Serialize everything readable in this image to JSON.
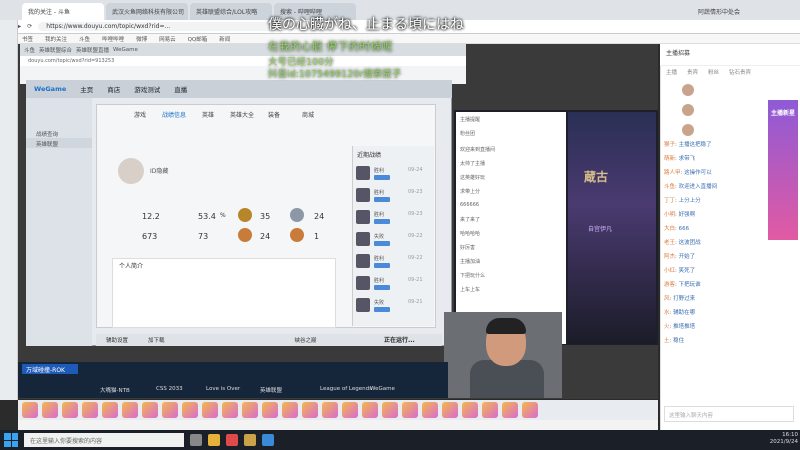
{
  "browser": {
    "tabs": [
      "我的关注 - 斗鱼",
      "武汉火鱼网络科技有限公司",
      "英雄联盟综合/LOL攻略",
      "搜索 - 哔哩哔哩"
    ],
    "url": "https://www.douyu.com/topic/wxd?rid=...",
    "bookmarks": [
      "书签",
      "我的关注",
      "斗鱼",
      "哔哩哔哩",
      "微博",
      "网易云",
      "QQ邮箱",
      "新闻"
    ],
    "user": "阿蔬情形中处会"
  },
  "inner_browser": {
    "tabs": [
      "斗鱼",
      "英雄联盟综合",
      "英雄联盟直播",
      "WeGame"
    ],
    "url": "douyu.com/topic/wxd?rid=913253"
  },
  "overlay": {
    "line1": "僕の心臓がね、止まる頃にはね",
    "line2": "在我的心脏 停下的时候呢",
    "line3": "大号已经100分",
    "line4": "抖音id:1075499120r搜索提子"
  },
  "wegame": {
    "logo": "WeGame",
    "nav": [
      "主页",
      "商店",
      "游戏测试",
      "直播"
    ],
    "side": [
      "战绩查询",
      "英雄联盟"
    ],
    "subtabs": [
      "游戏",
      "战绩信息",
      "英雄",
      "英雄大全",
      "装备",
      "商城"
    ],
    "player_name": "ID隐藏",
    "stats": {
      "s1": "12.2",
      "s2": "53.4",
      "s2_unit": "%",
      "s3": "35",
      "s4": "24",
      "s5": "673",
      "s6": "73",
      "s7": "24",
      "s8": "1"
    },
    "personal_title": "个人简介",
    "history_title": "近期战绩",
    "history": [
      {
        "label": "胜利",
        "time": "09-24"
      },
      {
        "label": "胜利",
        "time": "09-23"
      },
      {
        "label": "胜利",
        "time": "09-23"
      },
      {
        "label": "失败",
        "time": "09-22"
      },
      {
        "label": "胜利",
        "time": "09-22"
      },
      {
        "label": "胜利",
        "time": "09-21"
      },
      {
        "label": "失败",
        "time": "09-21"
      }
    ],
    "bottom": [
      "辅助设置",
      "加下载"
    ],
    "bottom_right": "峡谷之巅",
    "running": "正在运行..."
  },
  "stream": {
    "chat": [
      "主播提醒",
      "粉丝团",
      "欢迎来到直播间",
      "太帅了主播",
      "这英雄好玩",
      "求带上分",
      "666666",
      "来了来了",
      "哈哈哈哈",
      "好厉害",
      "主播加油",
      "下把玩什么",
      "上车上车"
    ],
    "art_title": "蔵古",
    "art_sub": "自宫伊凡"
  },
  "tray": [
    "万域碰撞-ROK",
    "大嘴猫-NTB",
    "CSS 2033",
    "Love is Over",
    "英雄联盟",
    "League of Legends",
    "WeGame"
  ],
  "side_chat": {
    "header": "主播招募",
    "tabs": [
      "主播",
      "贵宾",
      "粉丝",
      "钻石贵宾"
    ],
    "banner": "主播新星",
    "messages": [
      {
        "who": "猴子",
        "text": "主播这把稳了"
      },
      {
        "who": "萌新",
        "text": "求带飞"
      },
      {
        "who": "路人甲",
        "text": "这操作可以"
      },
      {
        "who": "斗鱼",
        "text": "欢迎进入直播间"
      },
      {
        "who": "丁丁",
        "text": "上分上分"
      },
      {
        "who": "小明",
        "text": "好强啊"
      },
      {
        "who": "大白",
        "text": "666"
      },
      {
        "who": "老王",
        "text": "这波团战"
      },
      {
        "who": "阿杰",
        "text": "开始了"
      },
      {
        "who": "小红",
        "text": "笑死了"
      },
      {
        "who": "游客",
        "text": "下把玩谁"
      },
      {
        "who": "风",
        "text": "打野过来"
      },
      {
        "who": "水",
        "text": "辅助在哪"
      },
      {
        "who": "火",
        "text": "推塔推塔"
      },
      {
        "who": "土",
        "text": "稳住"
      }
    ],
    "input_placeholder": "这里输入聊天内容"
  },
  "taskbar": {
    "search_placeholder": "在这里输入你要搜索的内容",
    "time": "16:10",
    "date": "2021/9/24"
  }
}
